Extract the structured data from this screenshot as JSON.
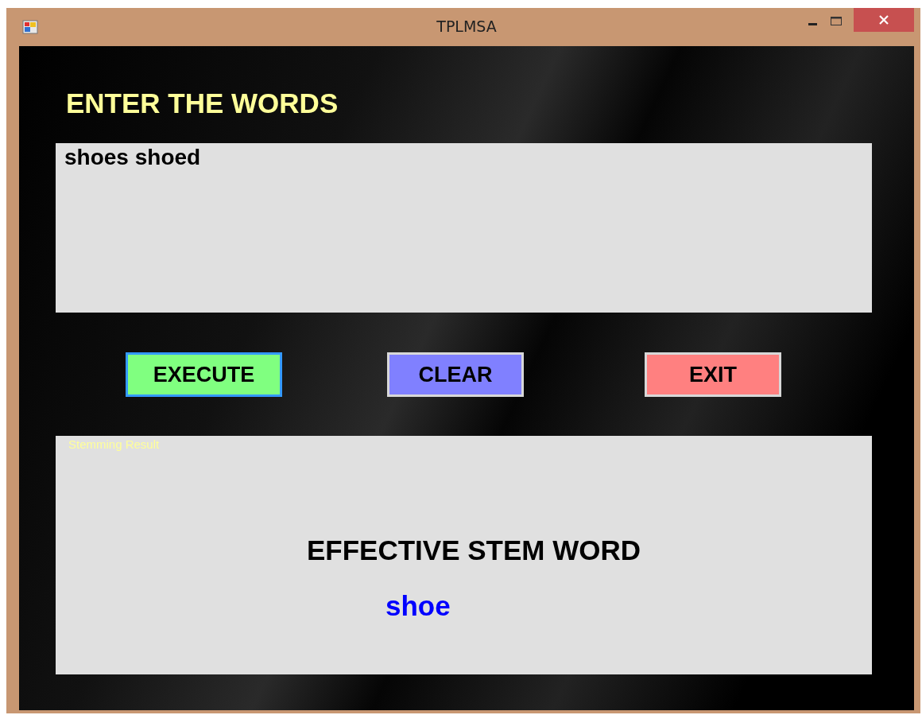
{
  "window": {
    "title": "TPLMSA"
  },
  "heading": "ENTER THE WORDS",
  "input": {
    "value": "shoes shoed"
  },
  "buttons": [
    {
      "label": "EXECUTE",
      "color": "#80ff80",
      "focused": true
    },
    {
      "label": "CLEAR",
      "color": "#8080ff",
      "focused": false
    },
    {
      "label": "EXIT",
      "color": "#ff8080",
      "focused": false
    }
  ],
  "result": {
    "group_label": "Stemming Result",
    "title": "EFFECTIVE STEM WORD",
    "value": "shoe"
  }
}
